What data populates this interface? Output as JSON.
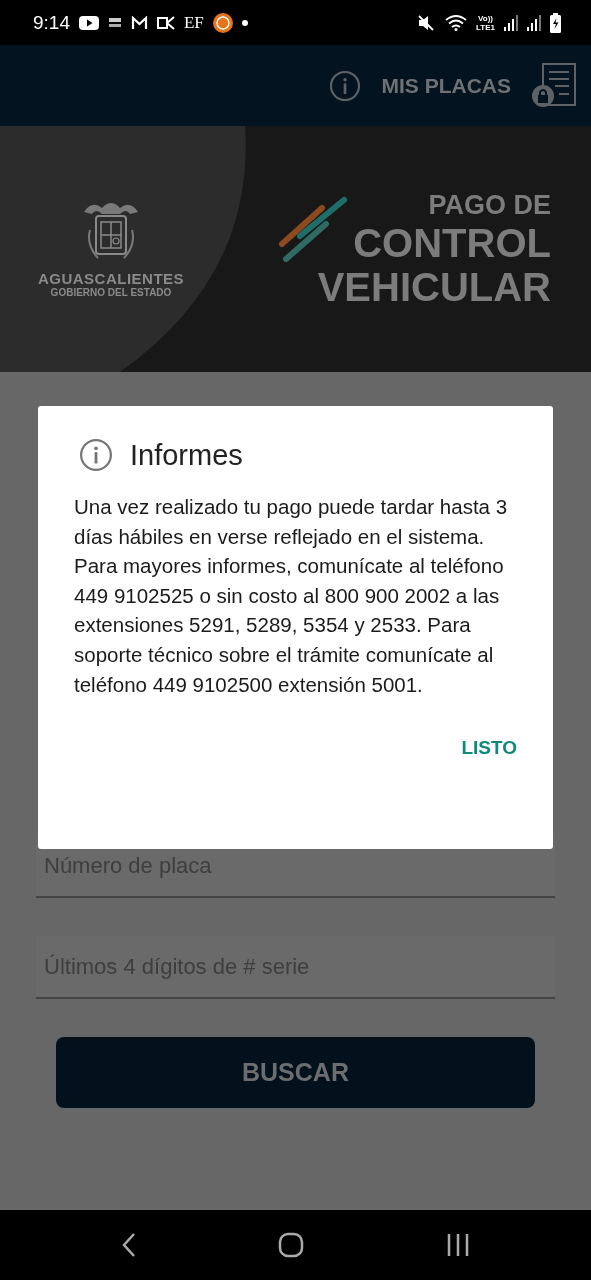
{
  "status_bar": {
    "time": "9:14",
    "carrier_mark": "EF",
    "network_labels": [
      "Vo))",
      "LTE1"
    ]
  },
  "header": {
    "action": "MIS PLACAS"
  },
  "banner": {
    "org_name": "AGUASCALIENTES",
    "org_subtitle": "GOBIERNO DEL ESTADO",
    "title_lines": [
      "PAGO DE",
      "CONTROL",
      "VEHICULAR"
    ]
  },
  "form": {
    "fields": [
      {
        "placeholder": "Número de placa"
      },
      {
        "placeholder": "Últimos 4 dígitos de # serie"
      }
    ],
    "submit": "BUSCAR"
  },
  "dialog": {
    "title": "Informes",
    "message": "Una vez realizado tu pago puede tardar hasta 3 días hábiles en verse reflejado en el sistema. Para mayores informes, comunícate al teléfono 449 9102525 o sin costo al 800 900 2002 a las extensiones 5291, 5289, 5354 y 2533. Para soporte técnico sobre el trámite comunícate al teléfono 449 9102500 extensión 5001.",
    "action": "LISTO"
  }
}
